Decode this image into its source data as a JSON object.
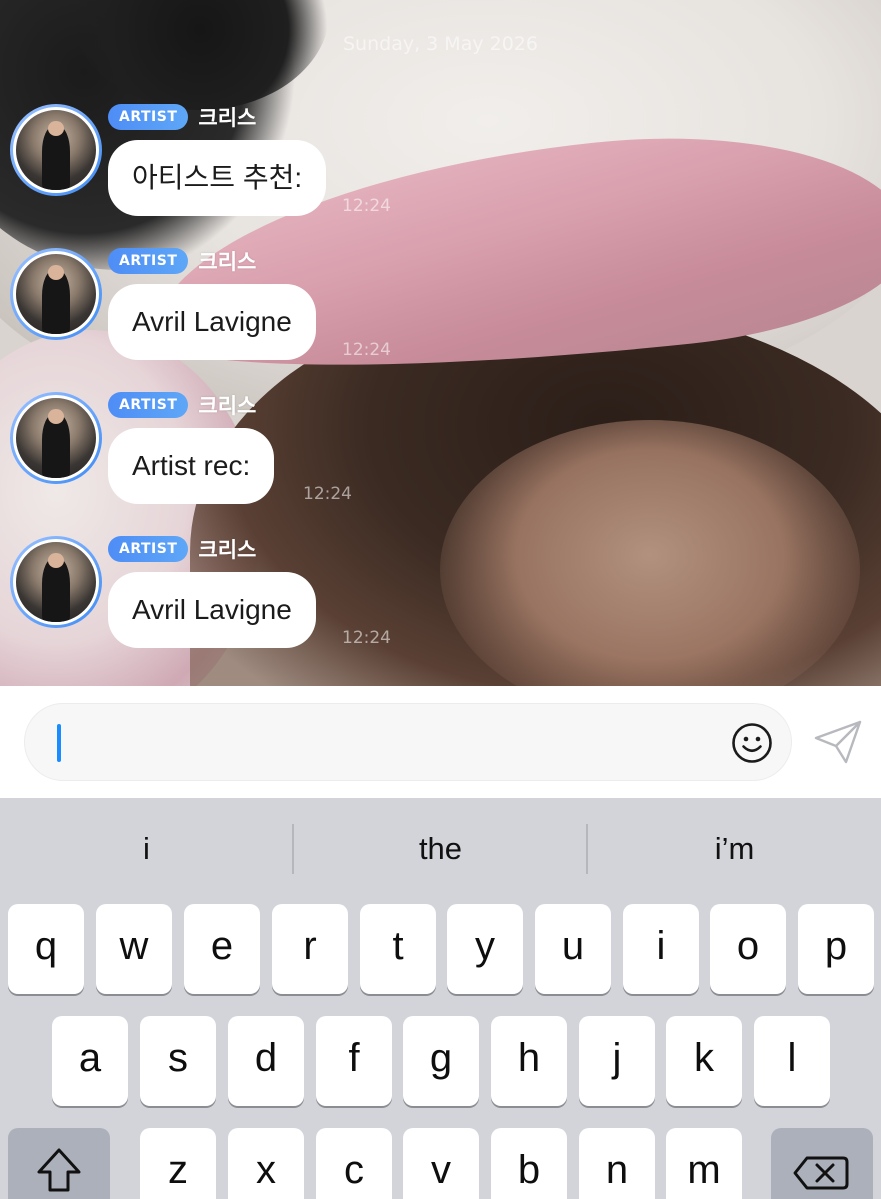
{
  "chat": {
    "date": "Sunday, 3 May 2026",
    "messages": [
      {
        "badge": "ARTIST",
        "sender": "크리스",
        "text": "아티스트 추천:",
        "time": "12:24"
      },
      {
        "badge": "ARTIST",
        "sender": "크리스",
        "text": "Avril Lavigne",
        "time": "12:24"
      },
      {
        "badge": "ARTIST",
        "sender": "크리스",
        "text": "Artist rec:",
        "time": "12:24"
      },
      {
        "badge": "ARTIST",
        "sender": "크리스",
        "text": "Avril Lavigne",
        "time": "12:24"
      }
    ]
  },
  "composer": {
    "placeholder": "",
    "value": "",
    "emoji_icon": "smiley-face-icon",
    "send_icon": "paper-plane-icon"
  },
  "keyboard": {
    "suggestions": [
      "i",
      "the",
      "i’m"
    ],
    "row1": [
      "q",
      "w",
      "e",
      "r",
      "t",
      "y",
      "u",
      "i",
      "o",
      "p"
    ],
    "row2": [
      "a",
      "s",
      "d",
      "f",
      "g",
      "h",
      "j",
      "k",
      "l"
    ],
    "row3": [
      "z",
      "x",
      "c",
      "v",
      "b",
      "n",
      "m"
    ],
    "shift_icon": "shift-arrow-icon",
    "delete_icon": "backspace-icon"
  },
  "colors": {
    "badge_gradient_start": "#4e8df6",
    "badge_gradient_end": "#5ea7f7",
    "caret": "#1a8cff",
    "keyboard_bg": "#d2d4da",
    "special_key_bg": "#abb0ba"
  }
}
